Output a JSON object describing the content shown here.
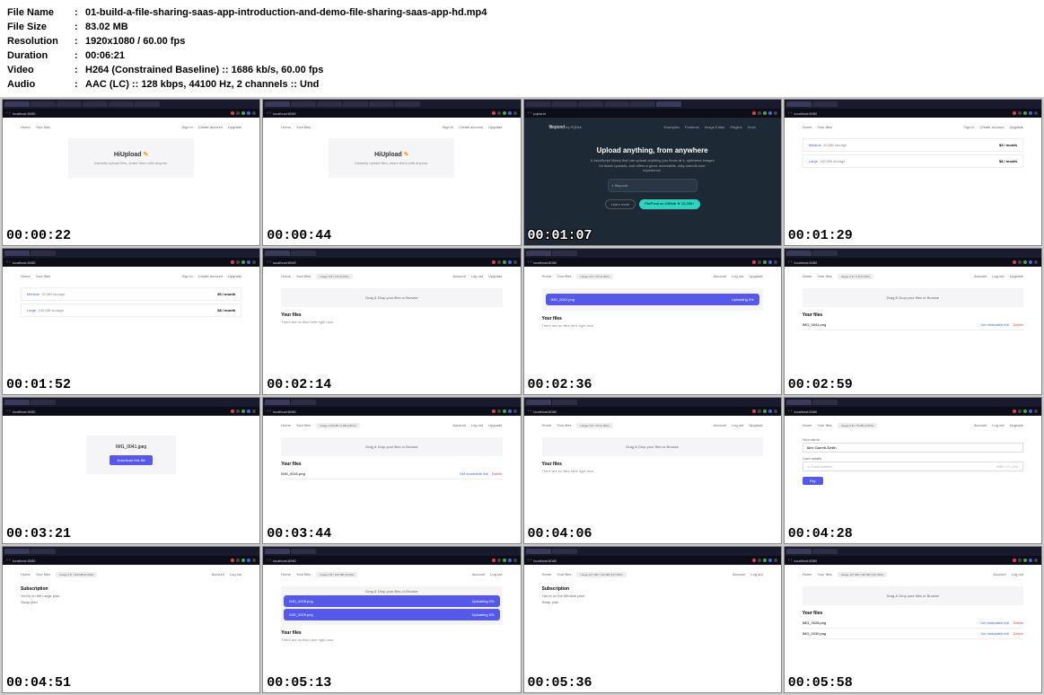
{
  "info": {
    "file_name_label": "File Name",
    "file_name": "01-build-a-file-sharing-saas-app-introduction-and-demo-file-sharing-saas-app-hd.mp4",
    "file_size_label": "File Size",
    "file_size": "83.02 MB",
    "resolution_label": "Resolution",
    "resolution": "1920x1080 / 60.00 fps",
    "duration_label": "Duration",
    "duration": "00:06:21",
    "video_label": "Video",
    "video": "H264 (Constrained Baseline) :: 1686 kb/s, 60.00 fps",
    "audio_label": "Audio",
    "audio": "AAC (LC) :: 128 kbps, 44100 Hz, 2 channels :: Und"
  },
  "timestamps": [
    "00:00:22",
    "00:00:44",
    "00:01:07",
    "00:01:29",
    "00:01:52",
    "00:02:14",
    "00:02:36",
    "00:02:59",
    "00:03:21",
    "00:03:44",
    "00:04:06",
    "00:04:28",
    "00:04:51",
    "00:05:13",
    "00:05:36",
    "00:05:58"
  ],
  "app": {
    "brand": "HiUpload",
    "tagline": "Instantly upload files, share them with anyone.",
    "nav_home": "Home",
    "nav_files": "Your files",
    "nav_signin": "Sign in",
    "nav_create": "Create account",
    "nav_upgrade": "Upgrade",
    "nav_account": "Account",
    "nav_logout": "Log out",
    "dropzone": "Drag & Drop your files or Browse",
    "your_files": "Your files",
    "empty": "There are no files here right now",
    "get_link": "Get shareable link",
    "delete": "Delete",
    "subscription": "Subscription",
    "download": "Download this file"
  },
  "plans": {
    "medium": {
      "name": "Medium",
      "desc": "50 MB storage",
      "price": "$5 / month"
    },
    "large": {
      "name": "Large",
      "desc": "100 MB storage",
      "price": "$8 / month"
    }
  },
  "usage": {
    "u1": "Usage 0 B / 0 B (0.00%)",
    "u2": "Usage 2.90 MB / 0 MB (INF%)",
    "u3": "Usage 0 B / 100 MB (0.00%)",
    "u4": "Usage 0 B / 75 MB (0.00%)",
    "u5": "Usage 107 MB / 100 MB (107.83%)"
  },
  "files": {
    "f1": "IMG_0041.png",
    "f2": "IMG_0041.jpeg",
    "f3": "IMG_0028.png",
    "f4": "IMG_0029.png",
    "f5": "IMG_0030.png"
  },
  "progress": {
    "p1": "Uploading 0%",
    "p2": "Uploading 5%"
  },
  "filepond": {
    "logo": "filepond",
    "by": "by PQINA",
    "nav": [
      "Examples",
      "Features",
      "Image Editor",
      "Plugins",
      "Docs"
    ],
    "title": "Upload anything, from anywhere",
    "sub": "A JavaScript library that can upload anything you throw at it, optimizes images for faster uploads, and offers a great, accessible, silky smooth user experience.",
    "learn": "Learn more",
    "github": "FilePond on GitHub ★ 10,200+",
    "drop": "filepond"
  },
  "checkout": {
    "name_label": "Your name",
    "name_value": "Alex Garrett-Smith",
    "card_label": "Card details",
    "card_placeholder": "Card number",
    "card_hint": "MM / YY  CVC",
    "pay": "Pay"
  },
  "sub_plans": {
    "large": "You're on the Large plan.",
    "medium": "You're on the Medium plan.",
    "swap": "Swap plan"
  },
  "url": "localhost:8080"
}
